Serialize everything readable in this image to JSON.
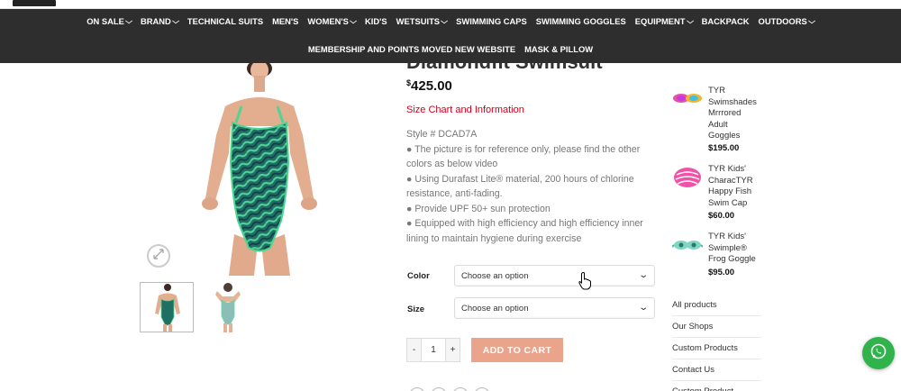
{
  "nav": {
    "row1": [
      {
        "label": "ON SALE",
        "dropdown": true
      },
      {
        "label": "BRAND",
        "dropdown": true
      },
      {
        "label": "TECHNICAL SUITS",
        "dropdown": false
      },
      {
        "label": "MEN'S",
        "dropdown": false
      },
      {
        "label": "WOMEN'S",
        "dropdown": true
      },
      {
        "label": "KID'S",
        "dropdown": false
      },
      {
        "label": "WETSUITS",
        "dropdown": true
      },
      {
        "label": "SWIMMING CAPS",
        "dropdown": false
      },
      {
        "label": "SWIMMING GOGGLES",
        "dropdown": false
      },
      {
        "label": "EQUIPMENT",
        "dropdown": true
      },
      {
        "label": "BACKPACK",
        "dropdown": false
      },
      {
        "label": "OUTDOORS",
        "dropdown": true
      }
    ],
    "row2": [
      {
        "label": "MEMBERSHIP AND POINTS MOVED NEW WEBSITE",
        "dropdown": false
      },
      {
        "label": "MASK & PILLOW",
        "dropdown": false
      }
    ]
  },
  "product": {
    "title": "Diamondfit Swimsuit",
    "currency": "$",
    "price": "425.00",
    "size_chart_link": "Size Chart and Information",
    "description": [
      "Style # DCAD7A",
      "● The picture is for reference only, please find the other colors as below video",
      "● Using Durafast Lite® material, 200 hours of chlorine resistance, anti-fading.",
      "● Provide UPF 50+ sun protection",
      "● Equipped with high efficiency and high efficiency inner lining to maintain hygiene during exercise"
    ],
    "options": [
      {
        "label": "Color",
        "placeholder": "Choose an option"
      },
      {
        "label": "Size",
        "placeholder": "Choose an option"
      }
    ],
    "quantity": "1",
    "qty_minus": "-",
    "qty_plus": "+",
    "add_to_cart": "ADD TO CART"
  },
  "sidebar": {
    "products": [
      {
        "name_lines": [
          "TYR",
          "Swimshades",
          "Mrrrored",
          "Adult",
          "Goggles"
        ],
        "price": "$195.00",
        "icon": "goggles-icon"
      },
      {
        "name_lines": [
          "TYR Kids'",
          "CharacTYR",
          "Happy Fish",
          "Swim Cap"
        ],
        "price": "$60.00",
        "icon": "swim-cap-icon"
      },
      {
        "name_lines": [
          "TYR Kids'",
          "Swimple®",
          "Frog Goggle"
        ],
        "price": "$95.00",
        "icon": "frog-goggle-icon"
      }
    ],
    "links": [
      "All products",
      "Our Shops",
      "Custom Products",
      "Contact Us",
      "Custom Product"
    ]
  },
  "colors": {
    "nav_bg": "#2e2e2e",
    "add_to_cart_bg": "#e9a48b",
    "size_chart_link": "#d0021b",
    "whatsapp": "#2fb34a"
  }
}
